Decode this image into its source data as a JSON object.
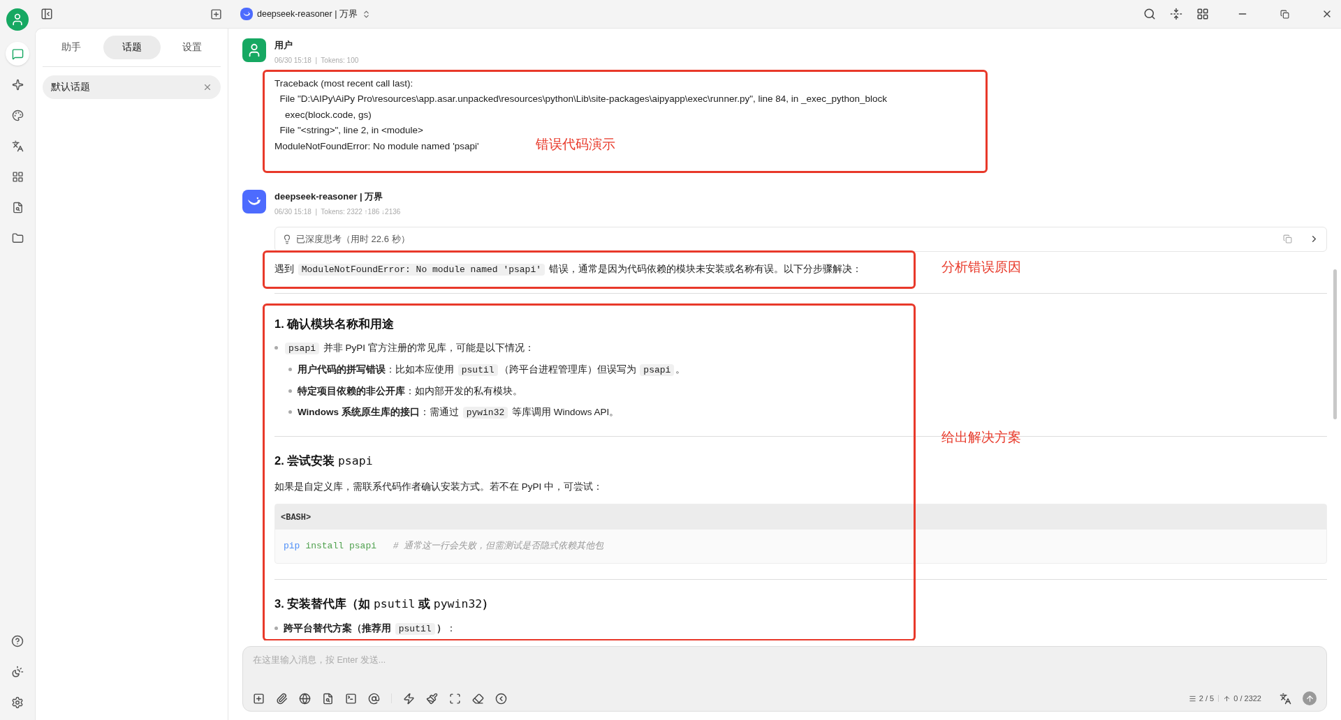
{
  "nav": [
    {
      "kind": "chat",
      "selected": true
    },
    {
      "kind": "sparkle",
      "selected": false
    },
    {
      "kind": "palette",
      "selected": false
    },
    {
      "kind": "translate",
      "selected": false
    },
    {
      "kind": "apps",
      "selected": false
    },
    {
      "kind": "files",
      "selected": false
    },
    {
      "kind": "folder",
      "selected": false
    }
  ],
  "bottom_nav": [
    {
      "kind": "help"
    },
    {
      "kind": "theme"
    },
    {
      "kind": "settings"
    }
  ],
  "tabs": [
    {
      "label": "助手",
      "selected": false
    },
    {
      "label": "话题",
      "selected": true
    },
    {
      "label": "设置",
      "selected": false
    }
  ],
  "topics": [
    {
      "label": "默认话题",
      "selected": true
    }
  ],
  "header": {
    "model": "deepseek-reasoner | 万界"
  },
  "user_message": {
    "name": "用户",
    "meta": "06/30 15:18  |  Tokens: 100",
    "annotation": "错误代码演示",
    "lines": [
      "Traceback (most recent call last):",
      "  File \"D:\\AIPy\\AiPy Pro\\resources\\app.asar.unpacked\\resources\\python\\Lib\\site-packages\\aipyapp\\exec\\runner.py\", line 84, in _exec_python_block",
      "    exec(block.code, gs)",
      "  File \"<string>\", line 2, in <module>",
      "ModuleNotFoundError: No module named 'psapi'"
    ]
  },
  "assistant_message": {
    "name": "deepseek-reasoner | 万界",
    "meta": "06/30 15:18  |  Tokens: 2322 ↑186 ↓2136",
    "thinking": "已深度思考（用时 22.6 秒）",
    "sections": [
      {
        "annotation": "分析错误原因",
        "blocks": [
          {
            "kind": "paragraph",
            "segments": [
              {
                "kind": "text",
                "text": "遇到 "
              },
              {
                "kind": "code",
                "text": "ModuleNotFoundError: No module named 'psapi'"
              },
              {
                "kind": "text",
                "text": " 错误，通常是因为代码依赖的模块未安装或名称有误。以下分步骤解决："
              }
            ]
          }
        ]
      },
      {
        "annotation": "给出解决方案",
        "blocks": [
          {
            "kind": "heading",
            "segments": [
              {
                "kind": "text",
                "text": "1. 确认模块名称和用途"
              }
            ]
          },
          {
            "kind": "list",
            "items": [
              {
                "segments": [
                  {
                    "kind": "code",
                    "text": "psapi"
                  },
                  {
                    "kind": "text",
                    "text": " 并非 PyPI 官方注册的常见库，可能是以下情况："
                  }
                ],
                "children": [
                  {
                    "segments": [
                      {
                        "kind": "bold",
                        "text": "用户代码的拼写错误"
                      },
                      {
                        "kind": "text",
                        "text": "：比如本应使用 "
                      },
                      {
                        "kind": "code",
                        "text": "psutil"
                      },
                      {
                        "kind": "text",
                        "text": "（跨平台进程管理库）但误写为 "
                      },
                      {
                        "kind": "code",
                        "text": "psapi"
                      },
                      {
                        "kind": "text",
                        "text": "。"
                      }
                    ]
                  },
                  {
                    "segments": [
                      {
                        "kind": "bold",
                        "text": "特定项目依赖的非公开库"
                      },
                      {
                        "kind": "text",
                        "text": "：如内部开发的私有模块。"
                      }
                    ]
                  },
                  {
                    "segments": [
                      {
                        "kind": "bold",
                        "text": "Windows 系统原生库的接口"
                      },
                      {
                        "kind": "text",
                        "text": "：需通过 "
                      },
                      {
                        "kind": "code",
                        "text": "pywin32"
                      },
                      {
                        "kind": "text",
                        "text": " 等库调用 Windows API。"
                      }
                    ]
                  }
                ]
              }
            ]
          },
          {
            "kind": "rule"
          },
          {
            "kind": "heading",
            "segments": [
              {
                "kind": "text",
                "text": "2. 尝试安装 "
              },
              {
                "kind": "mono",
                "text": "psapi"
              }
            ]
          },
          {
            "kind": "paragraph",
            "segments": [
              {
                "kind": "text",
                "text": "如果是自定义库，需联系代码作者确认安装方式。若不在 PyPI 中，可尝试："
              }
            ]
          },
          {
            "kind": "codeblock",
            "language": "<BASH>",
            "tokens": [
              {
                "kind": "command",
                "text": "pip"
              },
              {
                "kind": "argument",
                "text": "install"
              },
              {
                "kind": "argument",
                "text": "psapi"
              },
              {
                "kind": "comment",
                "text": "  # 通常这一行会失败，但需测试是否隐式依赖其他包"
              }
            ]
          },
          {
            "kind": "rule"
          },
          {
            "kind": "heading",
            "segments": [
              {
                "kind": "text",
                "text": "3. 安装替代库（如 "
              },
              {
                "kind": "mono",
                "text": "psutil"
              },
              {
                "kind": "text",
                "text": " 或 "
              },
              {
                "kind": "mono",
                "text": "pywin32"
              },
              {
                "kind": "text",
                "text": "）"
              }
            ]
          },
          {
            "kind": "list",
            "items": [
              {
                "segments": [
                  {
                    "kind": "bold",
                    "text": "跨平台替代方案（推荐用 "
                  },
                  {
                    "kind": "code",
                    "text": "psutil"
                  },
                  {
                    "kind": "bold",
                    "text": "）"
                  },
                  {
                    "kind": "text",
                    "text": "："
                  }
                ]
              }
            ]
          }
        ]
      }
    ]
  },
  "input": {
    "placeholder": "在这里输入消息，按 Enter 发送...",
    "context_count": "2 / 5",
    "token_count": "0 / 2322"
  }
}
